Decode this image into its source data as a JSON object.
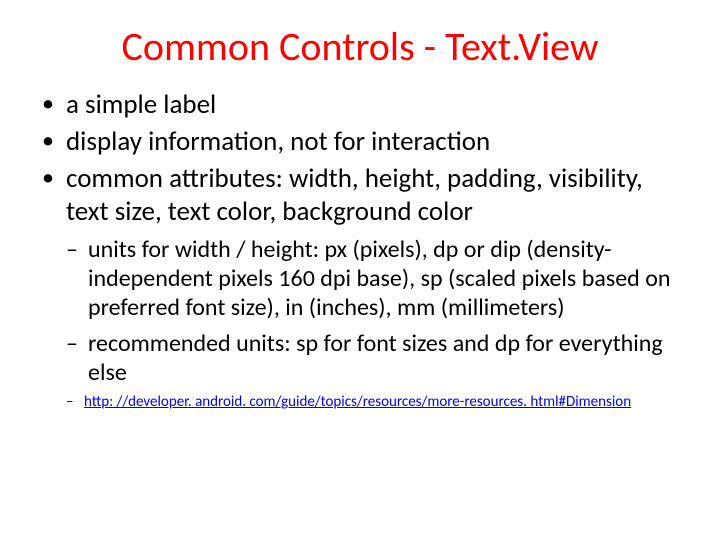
{
  "title": "Common Controls - Text.View",
  "bullets": {
    "l1": [
      "a simple label",
      "display information, not for interaction",
      "common attributes: width, height, padding, visibility, text size, text color, background color"
    ],
    "l2": [
      "units for width / height: px (pixels), dp or dip (density-independent pixels 160 dpi base), sp (scaled pixels based on preferred font size), in (inches), mm (millimeters)",
      "recommended units: sp for font sizes and dp for everything else"
    ],
    "l3link": "http: //developer. android. com/guide/topics/resources/more-resources. html#Dimension"
  }
}
